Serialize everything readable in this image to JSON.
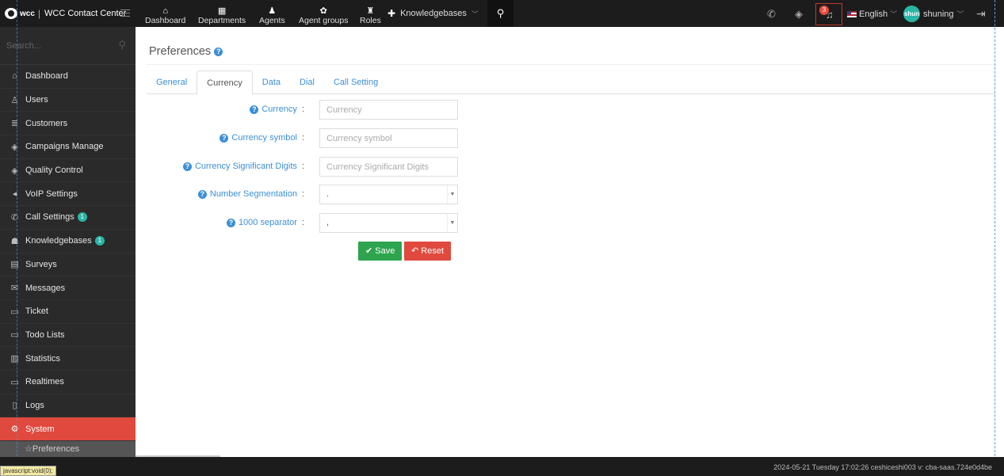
{
  "brand": {
    "mark": "wcc",
    "title": "WCC Contact Center"
  },
  "topnav": [
    {
      "icon": "home-icon",
      "glyph": "⌂",
      "label": "Dashboard"
    },
    {
      "icon": "departments-icon",
      "glyph": "▦",
      "label": "Departments"
    },
    {
      "icon": "agents-icon",
      "glyph": "♟",
      "label": "Agents"
    },
    {
      "icon": "agent-groups-icon",
      "glyph": "✿",
      "label": "Agent groups"
    },
    {
      "icon": "roles-icon",
      "glyph": "♜",
      "label": "Roles"
    }
  ],
  "kb_menu": {
    "label": "Knowledgebases"
  },
  "notifications": {
    "count": "3"
  },
  "language": {
    "label": "English"
  },
  "user": {
    "avatar": "shun",
    "name": "shuning"
  },
  "sidebar": {
    "search_placeholder": "Search...",
    "items": [
      {
        "glyph": "⌂",
        "label": "Dashboard",
        "icon": "home-icon"
      },
      {
        "glyph": "♙",
        "label": "Users",
        "icon": "user-icon"
      },
      {
        "glyph": "≣",
        "label": "Customers",
        "icon": "database-icon"
      },
      {
        "glyph": "◈",
        "label": "Campaigns Manage",
        "icon": "layers-icon"
      },
      {
        "glyph": "◈",
        "label": "Quality Control",
        "icon": "layers-icon"
      },
      {
        "glyph": "◂",
        "label": "VoIP Settings",
        "icon": "volume-icon"
      },
      {
        "glyph": "✆",
        "label": "Call Settings",
        "icon": "phone-icon",
        "badge": "1"
      },
      {
        "glyph": "☗",
        "label": "Knowledgebases",
        "icon": "graduation-cap-icon",
        "badge": "1"
      },
      {
        "glyph": "▤",
        "label": "Surveys",
        "icon": "survey-icon"
      },
      {
        "glyph": "✉",
        "label": "Messages",
        "icon": "envelope-icon"
      },
      {
        "glyph": "▭",
        "label": "Ticket",
        "icon": "folder-icon"
      },
      {
        "glyph": "▭",
        "label": "Todo Lists",
        "icon": "folder-icon"
      },
      {
        "glyph": "▥",
        "label": "Statistics",
        "icon": "bar-chart-icon"
      },
      {
        "glyph": "▭",
        "label": "Realtimes",
        "icon": "monitor-icon"
      },
      {
        "glyph": "▯",
        "label": "Logs",
        "icon": "log-icon"
      },
      {
        "glyph": "⚙",
        "label": "System",
        "icon": "gear-icon",
        "active": true
      }
    ],
    "sub_item": "☆Preferences"
  },
  "page": {
    "title": "Preferences",
    "tabs": [
      "General",
      "Currency",
      "Data",
      "Dial",
      "Call Setting"
    ],
    "active_tab": "Currency"
  },
  "form": {
    "currency": {
      "label": "Currency",
      "placeholder": "Currency"
    },
    "currency_symbol": {
      "label": "Currency symbol",
      "placeholder": "Currency symbol"
    },
    "significant_digits": {
      "label": "Currency Significant Digits",
      "placeholder": "Currency Significant Digits"
    },
    "number_segmentation": {
      "label": "Number Segmentation",
      "value": "."
    },
    "thousand_separator": {
      "label": "1000 separator",
      "value": ","
    },
    "save_label": "Save",
    "reset_label": "Reset"
  },
  "status": {
    "text": "2024-05-21 Tuesday 17:02:26  ceshiceshi003  v: cba-saas.724e0d4be",
    "link_tip": "javascript:void(0);"
  }
}
